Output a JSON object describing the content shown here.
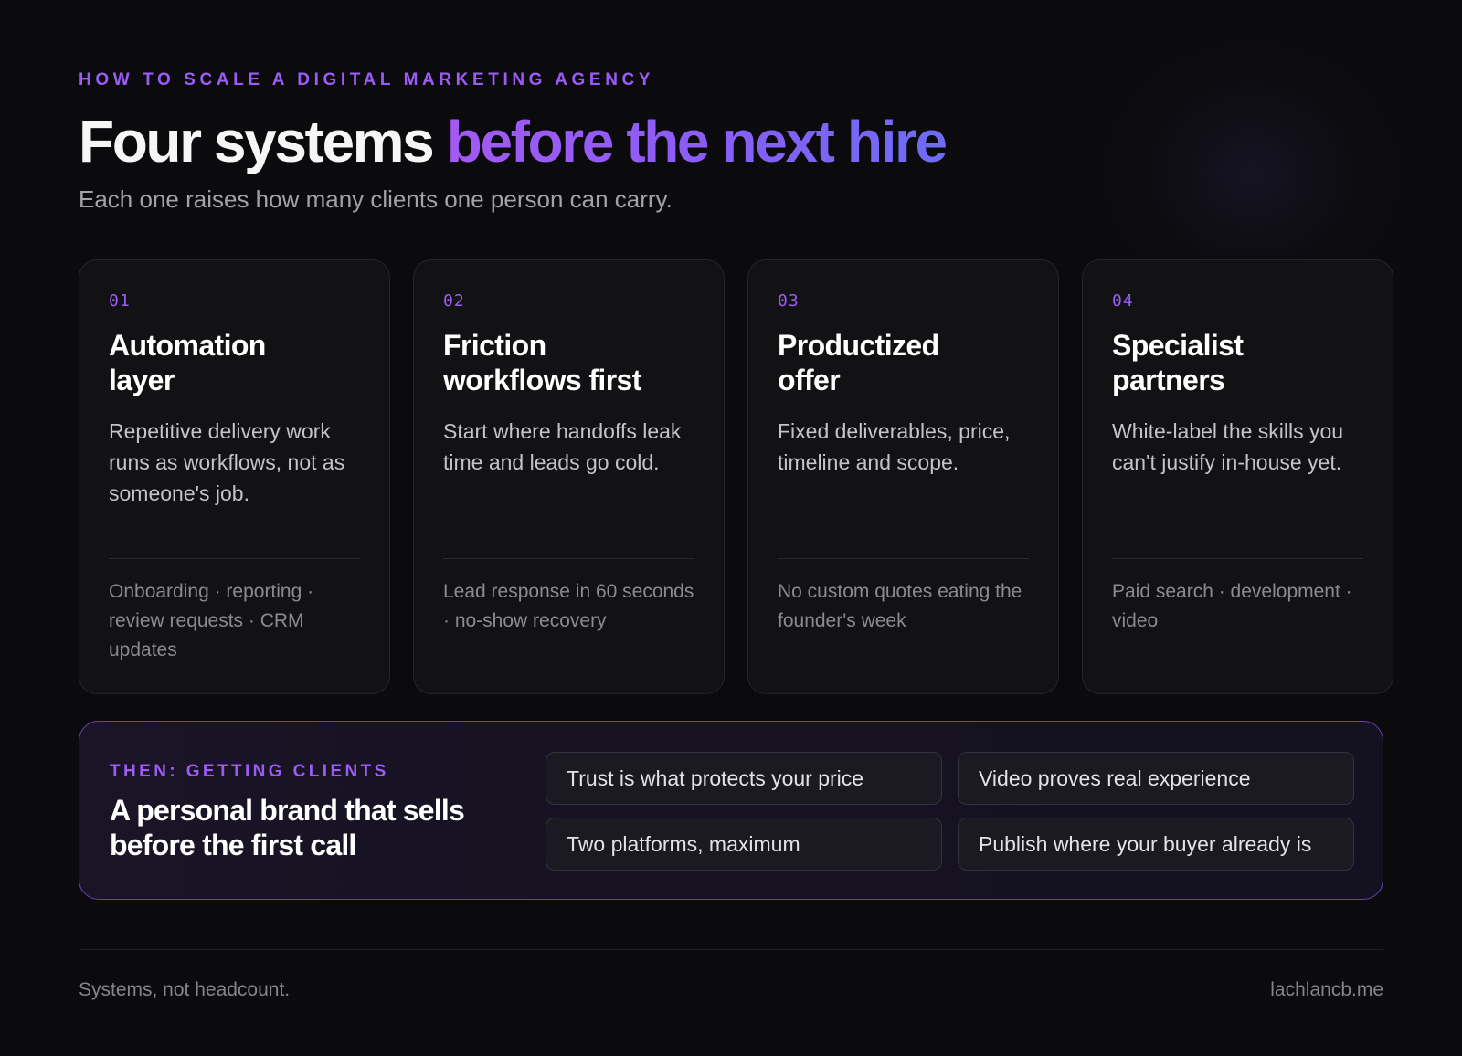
{
  "eyebrow": "HOW TO SCALE A DIGITAL MARKETING AGENCY",
  "headline": {
    "part1": "Four systems",
    "part2": "before the next hire"
  },
  "subhead": "Each one raises how many clients one person can carry.",
  "colors": {
    "accent": "#9b5cf6",
    "gradient_start": "#a35af3",
    "gradient_end": "#6d6cf3",
    "background": "#0b0b0d",
    "card_background": "#121214"
  },
  "cards": [
    {
      "num": "01",
      "title": "Automation\nlayer",
      "desc": "Repetitive delivery work runs as workflows, not as someone's job.",
      "tags": "Onboarding · reporting · review requests · CRM updates"
    },
    {
      "num": "02",
      "title": "Friction\nworkflows first",
      "desc": "Start where handoffs leak time and leads go cold.",
      "tags": "Lead response in 60 seconds · no-show recovery"
    },
    {
      "num": "03",
      "title": "Productized\noffer",
      "desc": "Fixed deliverables, price, timeline and scope.",
      "tags": "No custom quotes eating the founder's week"
    },
    {
      "num": "04",
      "title": "Specialist\npartners",
      "desc": "White-label the skills you can't justify in-house yet.",
      "tags": "Paid search · development · video"
    }
  ],
  "cta": {
    "eyebrow": "THEN: GETTING CLIENTS",
    "title": "A personal brand that sells before the first call",
    "chips": [
      "Trust is what protects your price",
      "Video proves real experience",
      "Two platforms, maximum",
      "Publish where your buyer already is"
    ]
  },
  "footer": {
    "left": "Systems, not headcount.",
    "right": "lachlancb.me"
  }
}
